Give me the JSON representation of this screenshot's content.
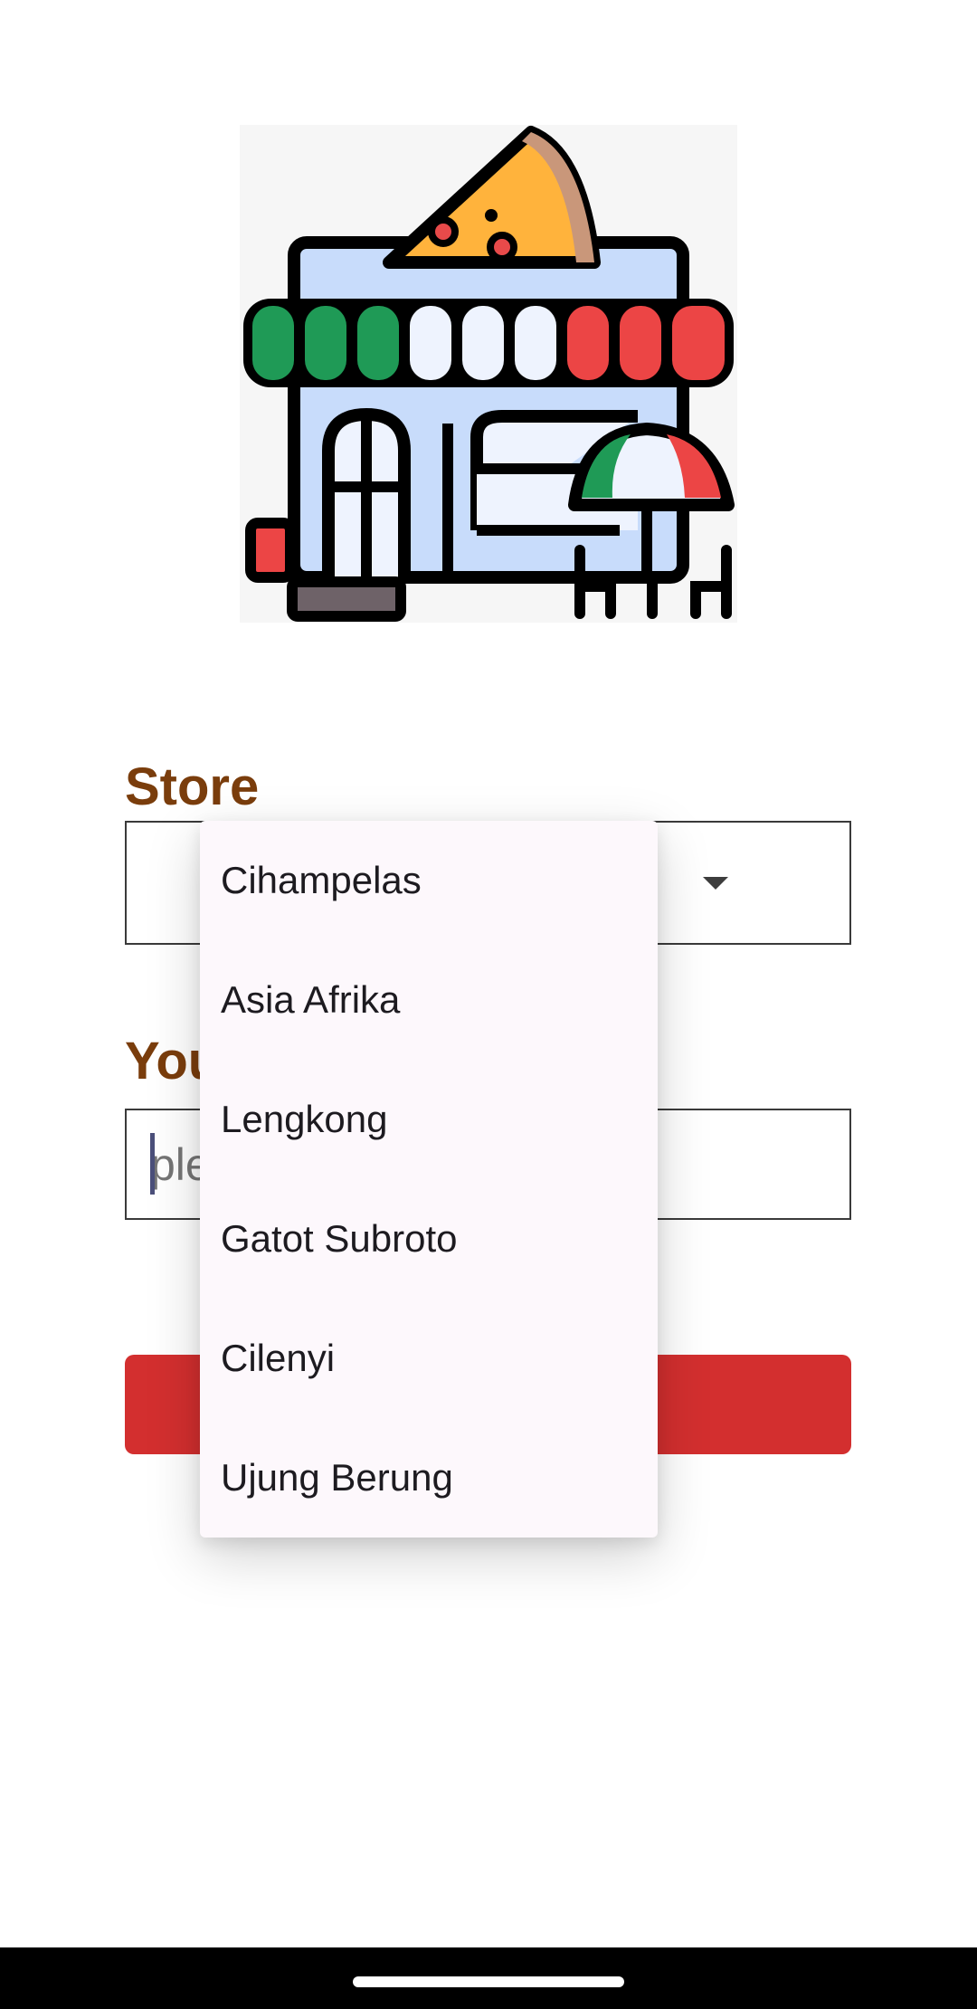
{
  "form": {
    "store_label": "Store",
    "your_label": "You",
    "name_placeholder": "ple",
    "submit_label": ""
  },
  "dropdown": {
    "options": [
      "Cihampelas",
      "Asia Afrika",
      "Lengkong",
      "Gatot Subroto",
      "Cilenyi",
      "Ujung Berung"
    ]
  },
  "colors": {
    "label": "#7a3d0c",
    "button": "#d32f2f",
    "dropdown_bg": "#fdf8fc"
  },
  "icons": {
    "logo": "pizza-store-icon",
    "select_arrow": "dropdown-arrow-icon"
  }
}
